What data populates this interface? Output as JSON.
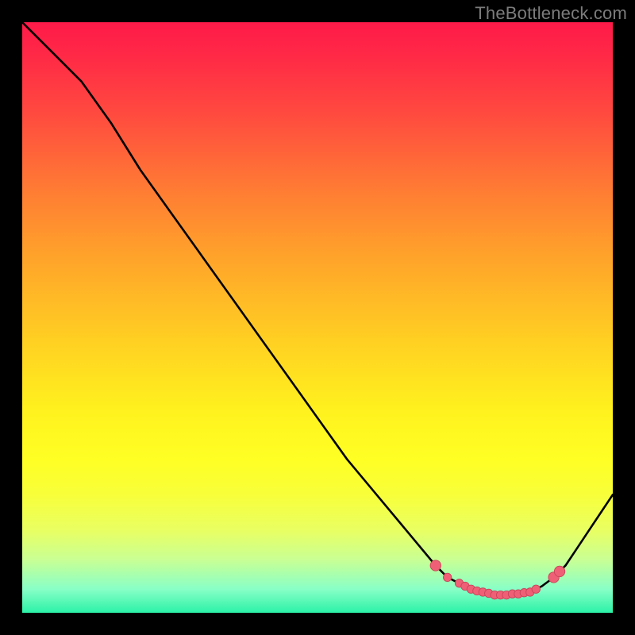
{
  "attribution": "TheBottleneck.com",
  "colors": {
    "background": "#000000",
    "attribution_text": "#7c7c7c",
    "curve": "#000000",
    "marker_fill": "#ef6077",
    "marker_stroke": "#c94459",
    "gradient_top": "#ff1a49",
    "gradient_bottom": "#2bf2a7"
  },
  "chart_data": {
    "type": "line",
    "title": "",
    "xlabel": "",
    "ylabel": "",
    "xlim": [
      0,
      100
    ],
    "ylim": [
      0,
      100
    ],
    "series": [
      {
        "name": "curve",
        "x": [
          0,
          5,
          10,
          15,
          20,
          25,
          30,
          35,
          40,
          45,
          50,
          55,
          60,
          65,
          70,
          72,
          74,
          76,
          78,
          80,
          82,
          84,
          86,
          88,
          90,
          92,
          94,
          96,
          98,
          100
        ],
        "y": [
          100,
          95,
          90,
          83,
          75,
          68,
          61,
          54,
          47,
          40,
          33,
          26,
          20,
          14,
          8,
          6,
          5,
          4,
          3.5,
          3,
          3,
          3,
          3.5,
          4.5,
          6,
          8,
          11,
          14,
          17,
          20
        ]
      }
    ],
    "markers": {
      "name": "highlight",
      "x": [
        70,
        72,
        74,
        75,
        76,
        77,
        78,
        79,
        80,
        81,
        82,
        83,
        84,
        85,
        86,
        87,
        90,
        91
      ],
      "y": [
        8,
        6,
        5,
        4.5,
        4,
        3.7,
        3.5,
        3.3,
        3,
        3,
        3,
        3.2,
        3.2,
        3.4,
        3.5,
        4,
        6,
        7
      ]
    }
  }
}
